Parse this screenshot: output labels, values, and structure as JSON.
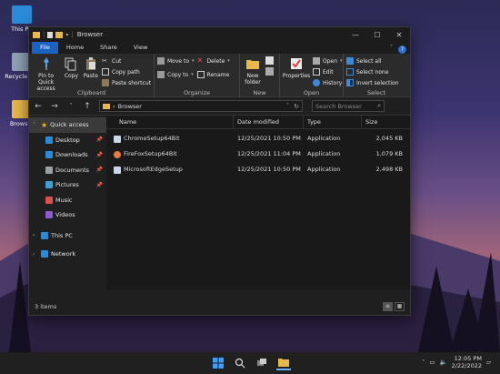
{
  "desktop": {
    "icons": [
      {
        "label": "This PC"
      },
      {
        "label": "Recycle Bin"
      },
      {
        "label": "Browser"
      }
    ]
  },
  "window": {
    "title": "Browser",
    "controls": {
      "minimize": "—",
      "maximize": "☐",
      "close": "✕"
    },
    "tabs": [
      {
        "label": "File"
      },
      {
        "label": "Home"
      },
      {
        "label": "Share"
      },
      {
        "label": "View"
      }
    ],
    "help": "?"
  },
  "ribbon": {
    "clipboard": {
      "label": "Clipboard",
      "pin": "Pin to Quick access",
      "copy": "Copy",
      "paste": "Paste",
      "cut": "Cut",
      "copy_path": "Copy path",
      "paste_shortcut": "Paste shortcut"
    },
    "organize": {
      "label": "Organize",
      "move_to": "Move to",
      "copy_to": "Copy to",
      "delete": "Delete",
      "rename": "Rename"
    },
    "new": {
      "label": "New",
      "new_folder": "New folder"
    },
    "open": {
      "label": "Open",
      "properties": "Properties",
      "open": "Open",
      "edit": "Edit",
      "history": "History"
    },
    "select": {
      "label": "Select",
      "select_all": "Select all",
      "select_none": "Select none",
      "invert_selection": "Invert selection"
    }
  },
  "address": {
    "separator": "›",
    "path": "Browser",
    "search_placeholder": "Search Browser"
  },
  "navpane": {
    "items": [
      {
        "label": "Quick access",
        "icon": "star-icon",
        "color": "#f0c000"
      },
      {
        "label": "Desktop",
        "icon": "desktop-icon",
        "color": "#2a8cd8"
      },
      {
        "label": "Downloads",
        "icon": "download-icon",
        "color": "#2a8cd8"
      },
      {
        "label": "Documents",
        "icon": "document-icon",
        "color": "#9aa0a6"
      },
      {
        "label": "Pictures",
        "icon": "picture-icon",
        "color": "#3ca0d8"
      },
      {
        "label": "Music",
        "icon": "music-icon",
        "color": "#e05050"
      },
      {
        "label": "Videos",
        "icon": "video-icon",
        "color": "#8a5cd0"
      },
      {
        "label": "This PC",
        "icon": "computer-icon",
        "color": "#2a8cd8"
      },
      {
        "label": "Network",
        "icon": "network-icon",
        "color": "#2a8cd8"
      }
    ]
  },
  "files": {
    "headers": {
      "name": "Name",
      "date": "Date modified",
      "type": "Type",
      "size": "Size"
    },
    "rows": [
      {
        "name": "ChromeSetup64Bit",
        "date": "12/25/2021 10:50 PM",
        "type": "Application",
        "size": "2,045 KB"
      },
      {
        "name": "FireFoxSetup64Bit",
        "date": "12/25/2021 11:04 PM",
        "type": "Application",
        "size": "1,079 KB"
      },
      {
        "name": "MicrosoftEdgeSetup",
        "date": "12/25/2021 10:50 PM",
        "type": "Application",
        "size": "2,498 KB"
      }
    ]
  },
  "status": {
    "count": "3 items"
  },
  "taskbar": {
    "time": "12:05 PM",
    "date": "2/22/2022"
  }
}
